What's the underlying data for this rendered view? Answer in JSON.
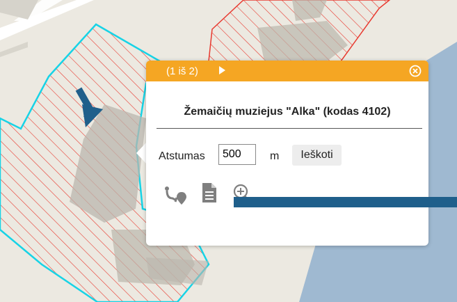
{
  "colors": {
    "map_background": "#ece9e1",
    "parcel_hatch": "#e8392f",
    "highlight_outline": "#17d3e6",
    "water": "#9fb9d1",
    "popup_header": "#f5a623",
    "arrow": "#1f5f8b"
  },
  "popup": {
    "pager_label": "(1 iš 2)",
    "title": "Žemaičių muziejus \"Alka\" (kodas 4102)",
    "distance_label": "Atstumas",
    "distance_value": "500",
    "unit_label": "m",
    "search_label": "Ieškoti",
    "icons": [
      "route-icon",
      "document-icon",
      "zoom-in-icon",
      "close-icon",
      "next-arrow-icon"
    ]
  }
}
